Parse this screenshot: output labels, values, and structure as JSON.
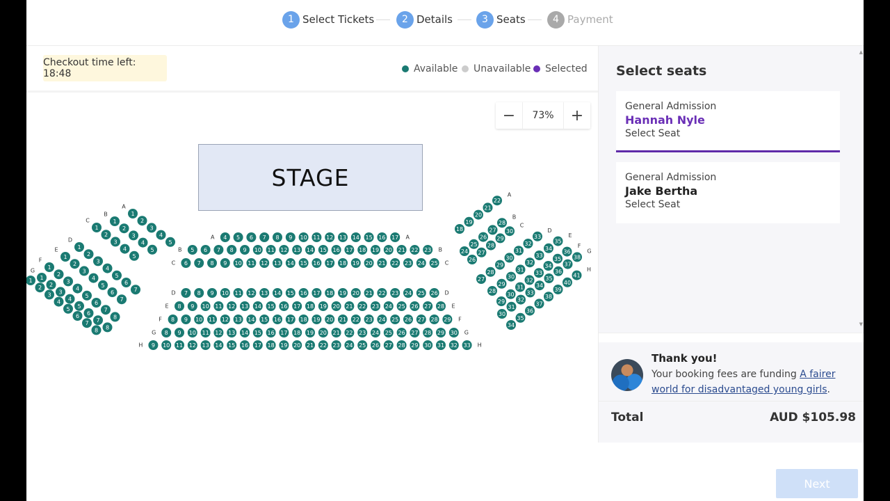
{
  "steps": [
    {
      "num": "1",
      "label": "Select Tickets"
    },
    {
      "num": "2",
      "label": "Details"
    },
    {
      "num": "3",
      "label": "Seats"
    },
    {
      "num": "4",
      "label": "Payment"
    }
  ],
  "timer": {
    "text": "Checkout time left: 18:48"
  },
  "legend": {
    "available": "Available",
    "unavailable": "Unavailable",
    "selected": "Selected",
    "colors": {
      "available": "#1a7a72",
      "unavailable": "#cccccc",
      "selected": "#6a2fb6"
    }
  },
  "zoom": {
    "minus": "−",
    "value": "73%",
    "plus": "+"
  },
  "stage": {
    "label": "STAGE"
  },
  "sidebar": {
    "title": "Select seats",
    "tickets": [
      {
        "type": "General Admission",
        "name": "Hannah Nyle",
        "action": "Select Seat"
      },
      {
        "type": "General Admission",
        "name": "Jake Bertha",
        "action": "Select Seat"
      }
    ],
    "thanks_title": "Thank you!",
    "thanks_text": "Your booking fees are funding ",
    "thanks_link": "A fairer world for disadvantaged young girls",
    "thanks_end": ".",
    "total_label": "Total",
    "total_value": "AUD $105.98"
  },
  "next": {
    "label": "Next"
  },
  "seating": {
    "center": [
      {
        "row": "A",
        "first": 4,
        "last": 17
      },
      {
        "row": "B",
        "first": 5,
        "last": 23
      },
      {
        "row": "C",
        "first": 6,
        "last": 25
      },
      {
        "row": "D",
        "first": 7,
        "last": 26
      },
      {
        "row": "E",
        "first": 8,
        "last": 28
      },
      {
        "row": "F",
        "first": 8,
        "last": 29
      },
      {
        "row": "G",
        "first": 8,
        "last": 30
      },
      {
        "row": "H",
        "first": 9,
        "last": 33
      }
    ],
    "left": [
      {
        "row": "A",
        "seats": [
          1,
          2,
          3,
          4,
          5
        ]
      },
      {
        "row": "B",
        "seats": [
          1,
          2,
          3,
          4,
          5
        ]
      },
      {
        "row": "C",
        "seats": [
          1,
          2,
          3,
          4,
          5
        ]
      },
      {
        "row": "D",
        "seats": [
          1,
          2,
          3,
          4,
          5,
          6,
          7
        ]
      },
      {
        "row": "E",
        "seats": [
          1,
          2,
          3,
          4,
          5,
          6,
          7
        ]
      },
      {
        "row": "F",
        "seats": [
          1,
          2,
          3,
          4,
          5,
          6,
          7,
          8
        ]
      },
      {
        "row": "G",
        "seats": [
          1,
          2,
          3,
          4,
          5,
          6,
          7,
          8
        ]
      },
      {
        "row": "H",
        "seats": [
          1,
          2,
          3,
          4,
          5,
          6,
          7,
          8
        ]
      }
    ],
    "right": [
      {
        "row": "A",
        "seats": [
          18,
          19,
          20,
          21,
          22
        ]
      },
      {
        "row": "B",
        "seats": [
          24,
          25,
          26,
          27,
          28
        ]
      },
      {
        "row": "C",
        "seats": [
          26,
          27,
          28,
          29,
          30
        ]
      },
      {
        "row": "D",
        "seats": [
          27,
          28,
          29,
          30,
          31,
          32,
          33
        ]
      },
      {
        "row": "E",
        "seats": [
          28,
          29,
          30,
          31,
          32,
          33,
          34,
          35
        ]
      },
      {
        "row": "F",
        "seats": [
          29,
          30,
          31,
          32,
          33,
          34,
          35,
          36
        ]
      },
      {
        "row": "G",
        "seats": [
          30,
          31,
          32,
          33,
          34,
          35,
          36,
          37,
          38
        ]
      },
      {
        "row": "H",
        "seats": [
          34,
          35,
          36,
          37,
          38,
          39,
          40,
          41
        ]
      }
    ]
  }
}
